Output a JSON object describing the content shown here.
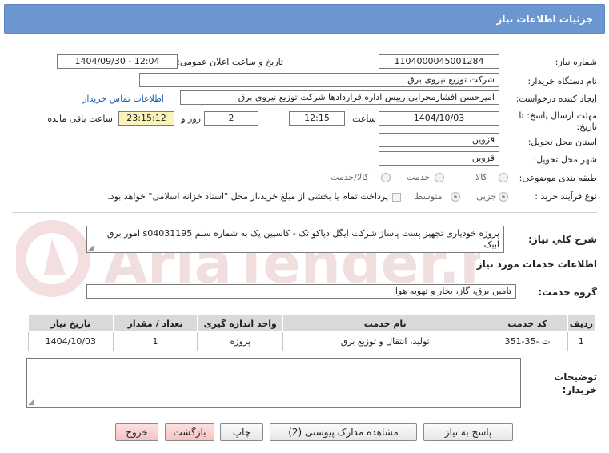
{
  "header": {
    "title": "جزئیات اطلاعات نیاز"
  },
  "fields": {
    "need_number_label": "شماره نیاز:",
    "need_number": "1104000045001284",
    "announce_label": "تاریخ و ساعت اعلان عمومی:",
    "announce_value": "1404/09/30 - 12:04",
    "buyer_org_label": "نام دستگاه خریدار:",
    "buyer_org": "شرکت توزیع نیروی برق",
    "creator_label": "ایجاد کننده درخواست:",
    "creator": "امیرحسن افشارمحرابی رییس اداره قراردادها شرکت توزیع نیروی برق",
    "contact_link": "اطلاعات تماس خریدار",
    "deadline_label_1": "مهلت ارسال پاسخ: تا",
    "deadline_label_2": "تاریخ:",
    "deadline_date": "1404/10/03",
    "time_label": "ساعت",
    "deadline_time": "12:15",
    "days": "2",
    "days_label": "روز و",
    "remaining_time": "23:15:12",
    "remaining_label": "ساعت باقی مانده",
    "province_label": "استان محل تحویل:",
    "province": "قزوین",
    "city_label": "شهر محل تحویل:",
    "city": "قزوین",
    "category_label": "طبقه بندی موضوعی:",
    "category_options": [
      "کالا",
      "خدمت",
      "کالا/خدمت"
    ],
    "process_label": "نوع فرآیند خرید :",
    "process_options": [
      "جزیی",
      "متوسط"
    ],
    "payment_note": "پرداخت تمام یا بخشی از مبلغ خرید،از محل \"اسناد خزانه اسلامی\" خواهد بود."
  },
  "description": {
    "label": "شرح كلي نياز:",
    "text": "پروژه خودیاری تجهیز پست پاساژ شرکت ایگل دیاکو تک - کاسپین یک به شماره سنم s04031195 امور برق ابیک"
  },
  "services": {
    "section_title": "اطلاعات خدمات مورد نیاز",
    "group_label": "گروه خدمت:",
    "group_value": "تامین برق، گاز، بخار و تهویه هوا",
    "columns": [
      "ردیف",
      "کد خدمت",
      "نام خدمت",
      "واحد اندازه گیری",
      "تعداد / مقدار",
      "تاریخ نیاز"
    ],
    "rows": [
      [
        "1",
        "ت -35-351",
        "تولید، انتقال و توزیع برق",
        "پروژه",
        "1",
        "1404/10/03"
      ]
    ]
  },
  "buyer_notes": {
    "label_1": "توضیحات",
    "label_2": "خریدار:"
  },
  "buttons": {
    "reply": "پاسخ به نیاز",
    "attachments": "مشاهده مدارک پیوستی (2)",
    "print": "چاپ",
    "back": "بازگشت",
    "exit": "خروج"
  },
  "watermark_text": "AriaTender.net"
}
